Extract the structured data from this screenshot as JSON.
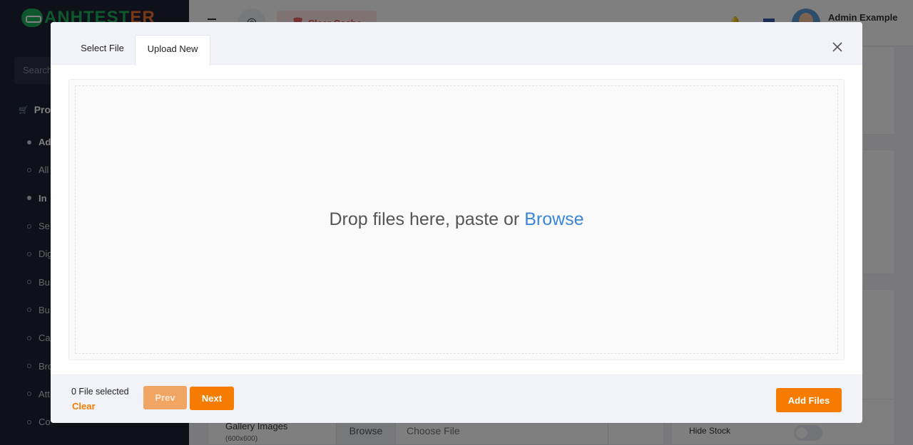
{
  "background": {
    "brand": {
      "text_main": "ANHTEST",
      "text_accent": "ER"
    },
    "sidebar": {
      "search_placeholder": "Search",
      "section_label": "Prod",
      "items": [
        {
          "label": "Ad",
          "active": true
        },
        {
          "label": "All",
          "active": false
        },
        {
          "label": "In",
          "active": true
        },
        {
          "label": "Se",
          "active": false
        },
        {
          "label": "Dig",
          "active": false
        },
        {
          "label": "Bu",
          "active": false
        },
        {
          "label": "Bu",
          "active": false
        },
        {
          "label": "Ca",
          "active": false
        },
        {
          "label": "Bro",
          "active": false
        },
        {
          "label": "Att",
          "active": false
        },
        {
          "label": "Co",
          "active": false
        }
      ]
    },
    "topbar": {
      "clear_cache_label": "Clear Cache",
      "user_name": "Admin Example"
    },
    "form": {
      "gallery_label": "Gallery Images",
      "gallery_sub": "(600x600)",
      "browse_label": "Browse",
      "choose_file_label": "Choose File",
      "hide_stock_label": "Hide Stock"
    }
  },
  "modal": {
    "tabs": [
      {
        "label": "Select File",
        "active": false
      },
      {
        "label": "Upload New",
        "active": true
      }
    ],
    "close_icon": "close-icon",
    "dropzone": {
      "text": "Drop files here, paste or",
      "browse_link": "Browse"
    },
    "footer": {
      "file_count": "0 File selected",
      "clear_label": "Clear",
      "prev_label": "Prev",
      "next_label": "Next",
      "add_files_label": "Add Files"
    }
  },
  "colors": {
    "accent": "#f57c00",
    "accent_disabled": "#f0a563",
    "link": "#3b86d9",
    "sidebar_bg": "#1e2235",
    "brand_green": "#1fb15a"
  }
}
